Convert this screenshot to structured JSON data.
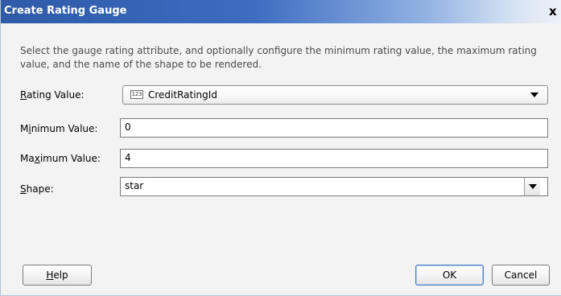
{
  "dialog": {
    "title": "Create Rating Gauge",
    "close_glyph": "x",
    "description": "Select the gauge rating attribute, and optionally configure the minimum rating value, the maximum rating value, and the name of the shape to be rendered."
  },
  "form": {
    "rating_value": {
      "label_mnemonic": "R",
      "label_rest": "ating Value:",
      "type_icon_text": "123",
      "value": "CreditRatingId"
    },
    "minimum_value": {
      "label_before": "M",
      "label_mnemonic": "i",
      "label_after": "nimum Value:",
      "value": "0"
    },
    "maximum_value": {
      "label_before": "Ma",
      "label_mnemonic": "x",
      "label_after": "imum Value:",
      "value": "4"
    },
    "shape": {
      "label_mnemonic": "S",
      "label_rest": "hape:",
      "value": "star"
    }
  },
  "buttons": {
    "help": {
      "mnemonic": "H",
      "rest": "elp"
    },
    "ok": "OK",
    "cancel": "Cancel"
  },
  "icons": {
    "rating_type": "numeric-type-icon",
    "dropdown": "chevron-down-icon",
    "close": "close-icon"
  }
}
